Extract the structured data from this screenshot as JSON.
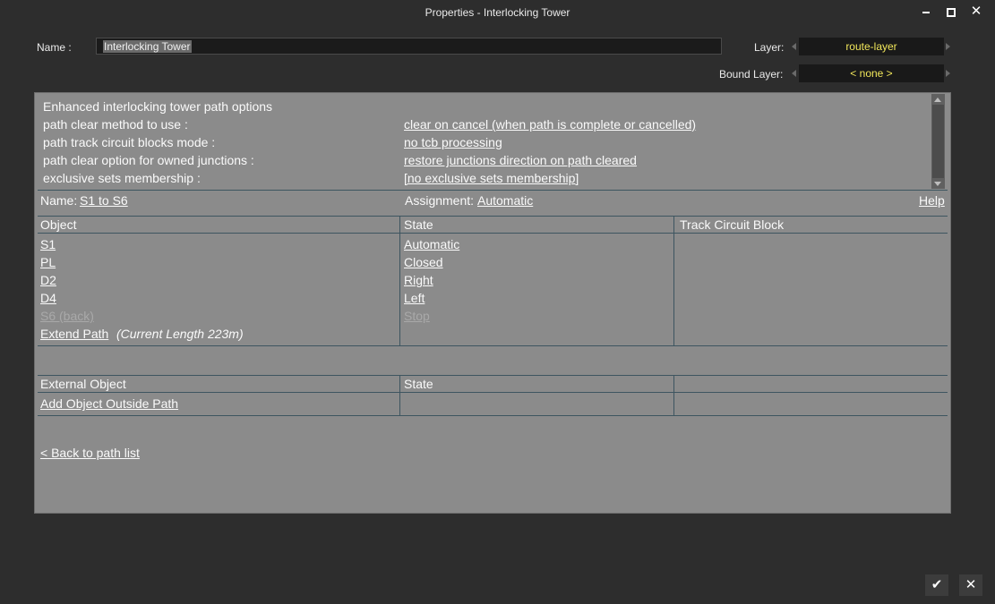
{
  "window": {
    "title": "Properties - Interlocking Tower"
  },
  "header": {
    "name_label": "Name :",
    "name_value": "Interlocking Tower",
    "layer_label": "Layer:",
    "layer_value": "route-layer",
    "bound_layer_label": "Bound Layer:",
    "bound_layer_value": "< none >"
  },
  "options": {
    "heading": "Enhanced interlocking tower path options",
    "rows": [
      {
        "label": "path clear method to use :",
        "value": "clear on cancel (when path is complete or cancelled)"
      },
      {
        "label": "path track circuit blocks mode :",
        "value": "no tcb processing"
      },
      {
        "label": "path clear option for owned junctions :",
        "value": "restore junctions direction on path cleared"
      },
      {
        "label": "exclusive sets membership :",
        "value": "[no exclusive sets membership]"
      }
    ]
  },
  "path": {
    "name_label": "Name:",
    "name_value": "S1 to S6",
    "assignment_label": "Assignment:",
    "assignment_value": "Automatic",
    "help": "Help"
  },
  "objects_table": {
    "headers": [
      "Object",
      "State",
      "Track Circuit Block"
    ],
    "rows": [
      {
        "object": "S1",
        "state": "Automatic",
        "enabled": true
      },
      {
        "object": "PL",
        "state": "Closed",
        "enabled": true
      },
      {
        "object": "D2",
        "state": "Right",
        "enabled": true
      },
      {
        "object": "D4",
        "state": "Left",
        "enabled": true
      },
      {
        "object": "S6 (back)",
        "state": "Stop",
        "enabled": false
      }
    ],
    "extend_path": "Extend Path",
    "current_length": "(Current Length 223m)"
  },
  "external_table": {
    "headers": [
      "External Object",
      "State",
      ""
    ],
    "add_link": "Add Object Outside Path"
  },
  "back_link": "< Back to path list",
  "colors": {
    "layer_text": "#f0e65a",
    "panel_bg": "#8b8b8b",
    "window_bg": "#2d2d2d"
  }
}
